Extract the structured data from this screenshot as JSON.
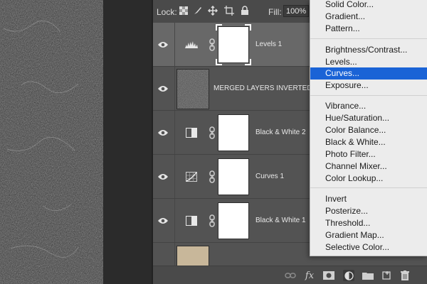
{
  "lockbar": {
    "lock_label": "Lock:",
    "fill_label": "Fill:",
    "fill_value": "100%"
  },
  "layers": [
    {
      "name": "Levels 1",
      "type": "levels",
      "selected": true
    },
    {
      "name": "MERGED LAYERS INVERTED",
      "type": "pixel",
      "selected": false
    },
    {
      "name": "Black & White 2",
      "type": "black-white",
      "selected": false
    },
    {
      "name": "Curves 1",
      "type": "curves",
      "selected": false
    },
    {
      "name": "Black & White 1",
      "type": "black-white",
      "selected": false
    },
    {
      "name": "",
      "type": "background",
      "selected": false
    }
  ],
  "bottombar": {
    "fx_label": "fx"
  },
  "menu": {
    "groups": [
      [
        "Solid Color...",
        "Gradient...",
        "Pattern..."
      ],
      [
        "Brightness/Contrast...",
        "Levels...",
        "Curves...",
        "Exposure..."
      ],
      [
        "Vibrance...",
        "Hue/Saturation...",
        "Color Balance...",
        "Black & White...",
        "Photo Filter...",
        "Channel Mixer...",
        "Color Lookup..."
      ],
      [
        "Invert",
        "Posterize...",
        "Threshold...",
        "Gradient Map...",
        "Selective Color..."
      ]
    ],
    "highlighted": "Curves..."
  },
  "colors": {
    "panel_bg": "#535353",
    "selected_row": "#686868",
    "menu_bg": "#ececec",
    "menu_highlight": "#1a63d6"
  }
}
